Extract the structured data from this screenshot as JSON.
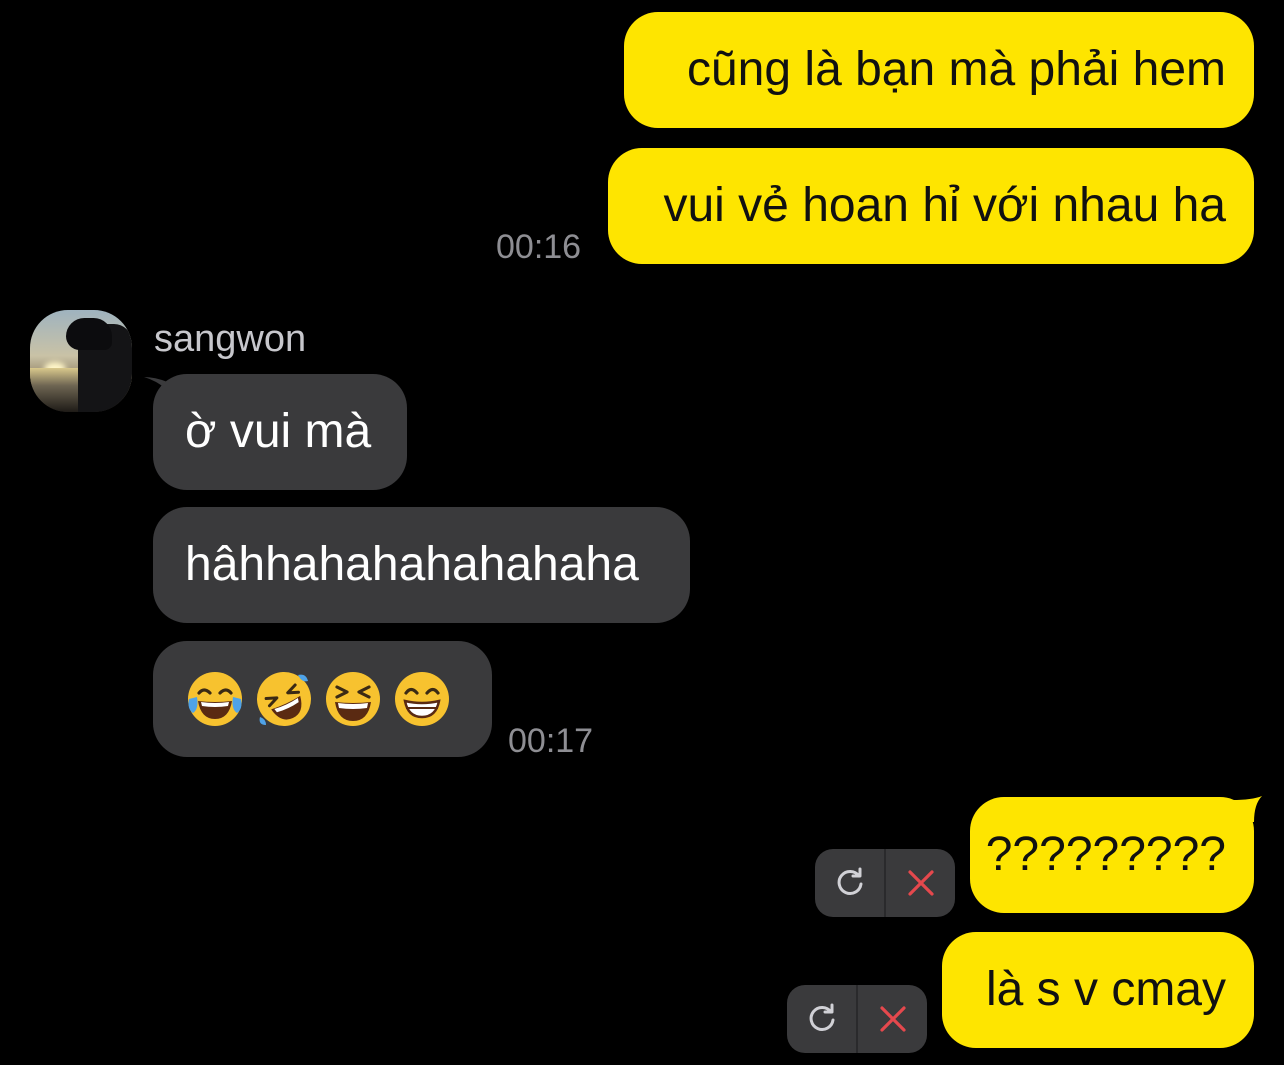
{
  "chat": {
    "sender_name": "sangwon",
    "messages": {
      "out_1": "cũng là bạn mà phải hem",
      "out_2": "vui vẻ hoan hỉ với nhau ha",
      "out_2_time": "00:16",
      "in_1": "ờ vui mà",
      "in_2": "hâhhahahahahahaha",
      "in_3_emojis": [
        "face-with-tears-of-joy",
        "rolling-on-the-floor-laughing",
        "grinning-squinting-face",
        "beaming-face-with-smiling-eyes"
      ],
      "in_3_time": "00:17",
      "out_3": "?????????",
      "out_4": "là s v cmay"
    },
    "failed_actions": {
      "retry_icon": "retry-icon",
      "delete_icon": "close-icon"
    }
  },
  "colors": {
    "background": "#000000",
    "outgoing_bubble": "#fee500",
    "incoming_bubble": "#3a3a3c",
    "timestamp": "#8e8e93",
    "delete_red": "#e5484d"
  }
}
